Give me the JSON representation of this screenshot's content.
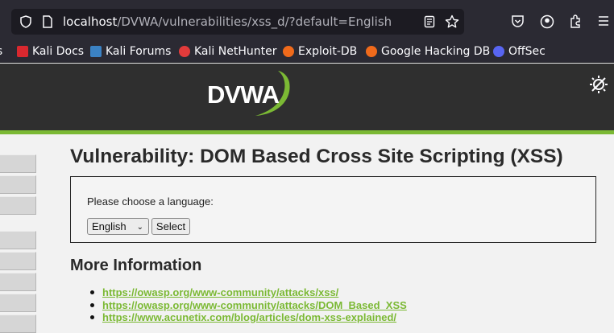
{
  "browser": {
    "url_host": "localhost",
    "url_path": "/DVWA/vulnerabilities/xss_d/?default=English",
    "bookmarks": [
      {
        "label": "ls",
        "color": "#e22"
      },
      {
        "label": "Kali Docs",
        "color": "#d9282f"
      },
      {
        "label": "Kali Forums",
        "color": "#3b82c4"
      },
      {
        "label": "Kali NetHunter",
        "color": "#e23b3b"
      },
      {
        "label": "Exploit-DB",
        "color": "#f06a1b"
      },
      {
        "label": "Google Hacking DB",
        "color": "#f06a1b"
      },
      {
        "label": "OffSec",
        "color": "#5865f2"
      }
    ]
  },
  "page": {
    "logo_text": "DVWA",
    "title": "Vulnerability: DOM Based Cross Site Scripting (XSS)",
    "prompt": "Please choose a language:",
    "selected_language": "English",
    "select_button": "Select",
    "more_info_heading": "More Information",
    "links": [
      "https://owasp.org/www-community/attacks/xss/",
      "https://owasp.org/www-community/attacks/DOM_Based_XSS",
      "https://www.acunetix.com/blog/articles/dom-xss-explained/"
    ],
    "accent_color": "#7bb934"
  }
}
